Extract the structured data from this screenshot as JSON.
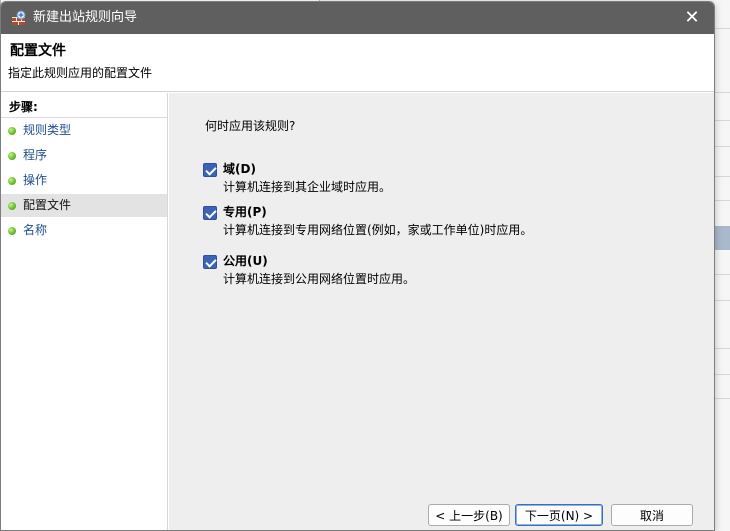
{
  "window": {
    "title": "新建出站规则向导",
    "close_glyph": "✕",
    "icon": "firewall-wizard-icon"
  },
  "header": {
    "title": "配置文件",
    "subtitle": "指定此规则应用的配置文件"
  },
  "steps": {
    "title": "步骤:",
    "items": [
      {
        "label": "规则类型",
        "active": false
      },
      {
        "label": "程序",
        "active": false
      },
      {
        "label": "操作",
        "active": false
      },
      {
        "label": "配置文件",
        "active": true
      },
      {
        "label": "名称",
        "active": false
      }
    ]
  },
  "content": {
    "question": "何时应用该规则?",
    "options": [
      {
        "label": "域(D)",
        "description": "计算机连接到其企业域时应用。",
        "checked": true
      },
      {
        "label": "专用(P)",
        "description": "计算机连接到专用网络位置(例如，家或工作单位)时应用。",
        "checked": true
      },
      {
        "label": "公用(U)",
        "description": "计算机连接到公用网络位置时应用。",
        "checked": true
      }
    ]
  },
  "buttons": {
    "back": "< 上一步(B)",
    "next": "下一页(N) >",
    "cancel": "取消"
  },
  "colors": {
    "titlebar": "#5f5f5f",
    "checkbox": "#3c63b5",
    "step_link": "#1f4f8f",
    "step_dot": "#6bbf2c"
  }
}
